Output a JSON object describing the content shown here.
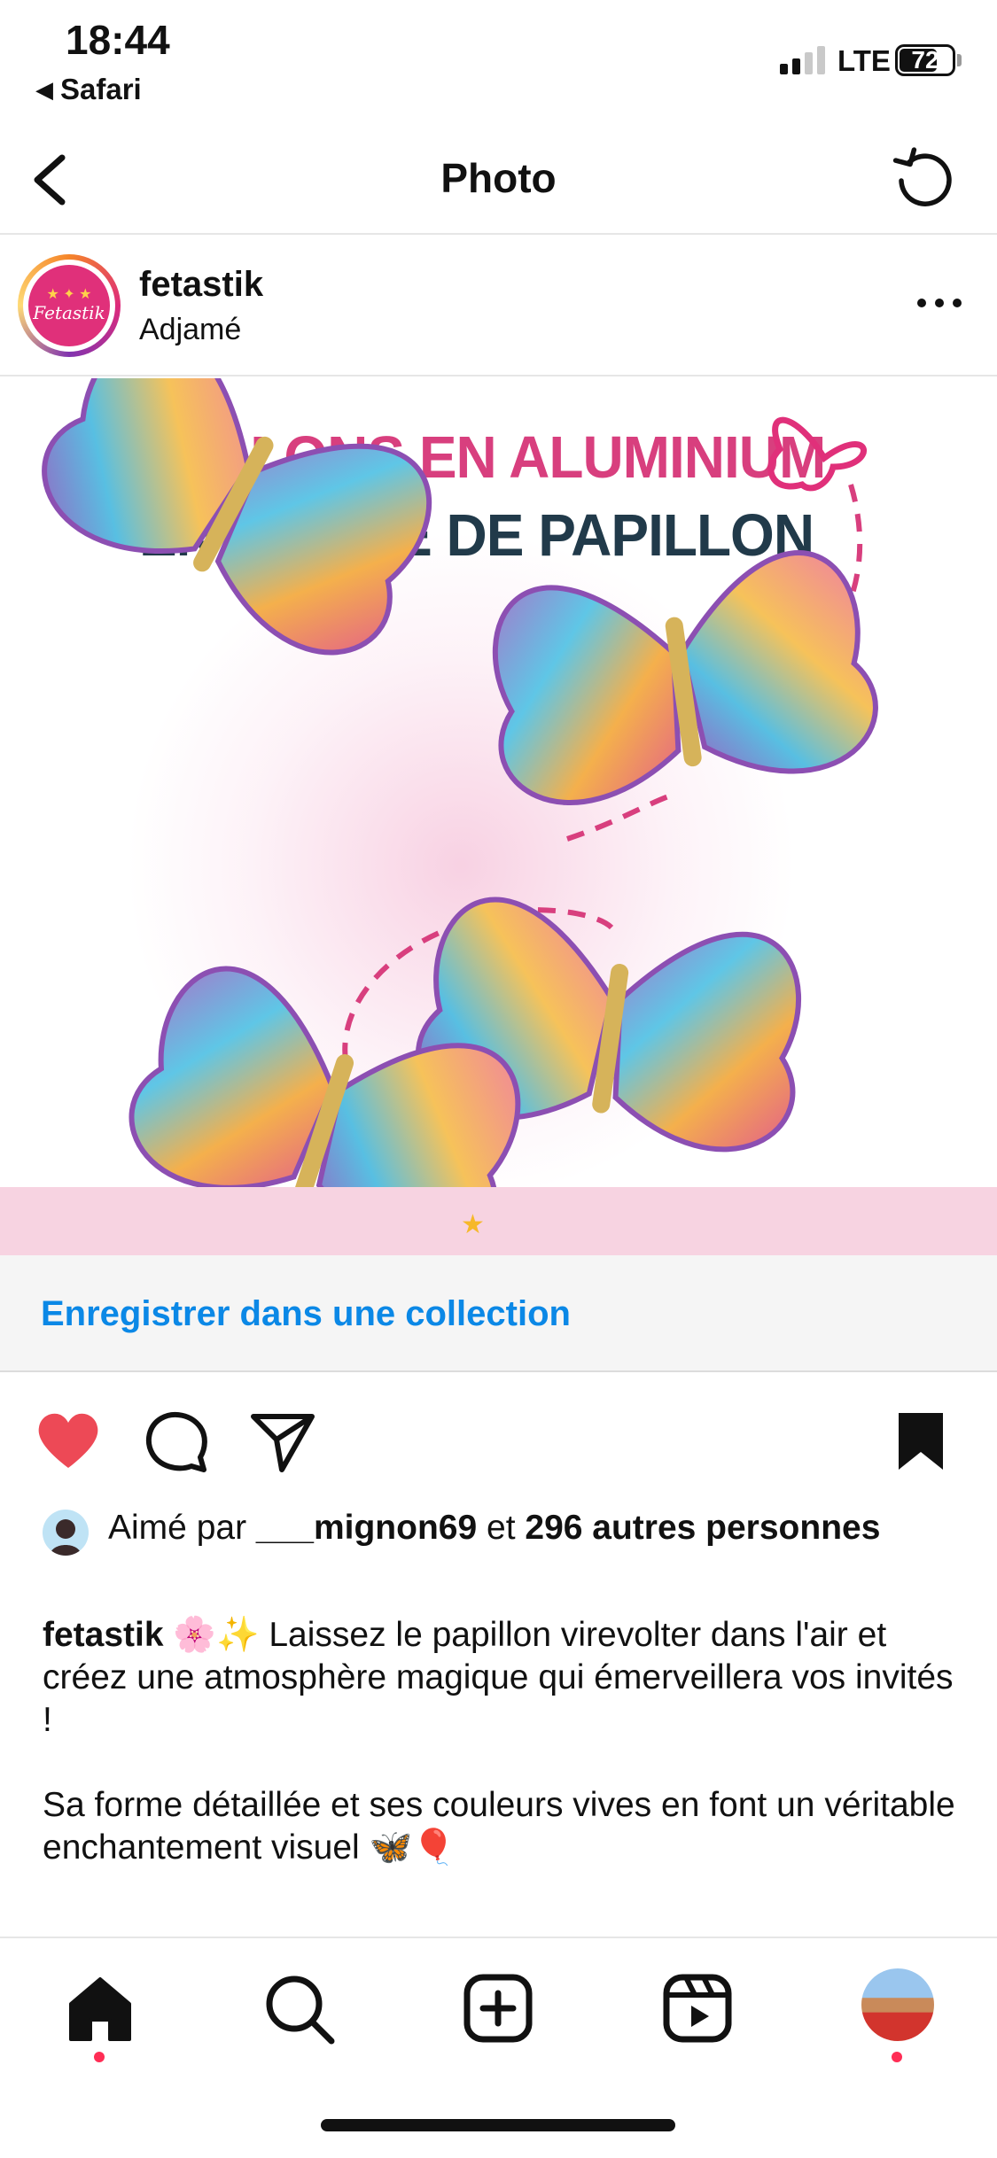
{
  "status_bar": {
    "time": "18:44",
    "back_app": "Safari",
    "network": "LTE",
    "battery": "72"
  },
  "header": {
    "title": "Photo",
    "back_icon": "chevron-left-icon",
    "right_icon": "refresh-icon"
  },
  "post": {
    "username": "fetastik",
    "location": "Adjamé",
    "avatar_text": "Fetastik",
    "more_icon": "more-horizontal-icon",
    "image": {
      "headline_line1": "BALLONS EN ALUMINIUM",
      "headline_line2": "EN FORME DE PAPILLON",
      "band_stars": "★",
      "colors": {
        "headline1": "#d83f7e",
        "headline2": "#213a4a",
        "band": "#f7d3e1"
      }
    },
    "save_to_collection": "Enregistrer dans une collection",
    "actions": {
      "like_icon": "heart-filled-icon",
      "comment_icon": "comment-icon",
      "share_icon": "send-icon",
      "save_icon": "bookmark-filled-icon"
    },
    "likes": {
      "prefix": "Aimé par ",
      "user": "___mignon69",
      "middle": " et ",
      "count": "296 autres personnes"
    },
    "caption": {
      "user": "fetastik",
      "text1": " 🌸✨ Laissez le papillon virevolter dans l'air et créez une atmosphère magique qui émerveillera vos invités !",
      "text2": "Sa forme détaillée et ses couleurs vives en font un véritable enchantement visuel 🦋🎈"
    }
  },
  "tab_bar": {
    "items": [
      "home-icon",
      "search-icon",
      "create-icon",
      "reels-icon",
      "profile-avatar"
    ]
  },
  "colors": {
    "link_blue": "#0b88e6",
    "like_red": "#ed4956",
    "notification_dot": "#ff2d55"
  }
}
